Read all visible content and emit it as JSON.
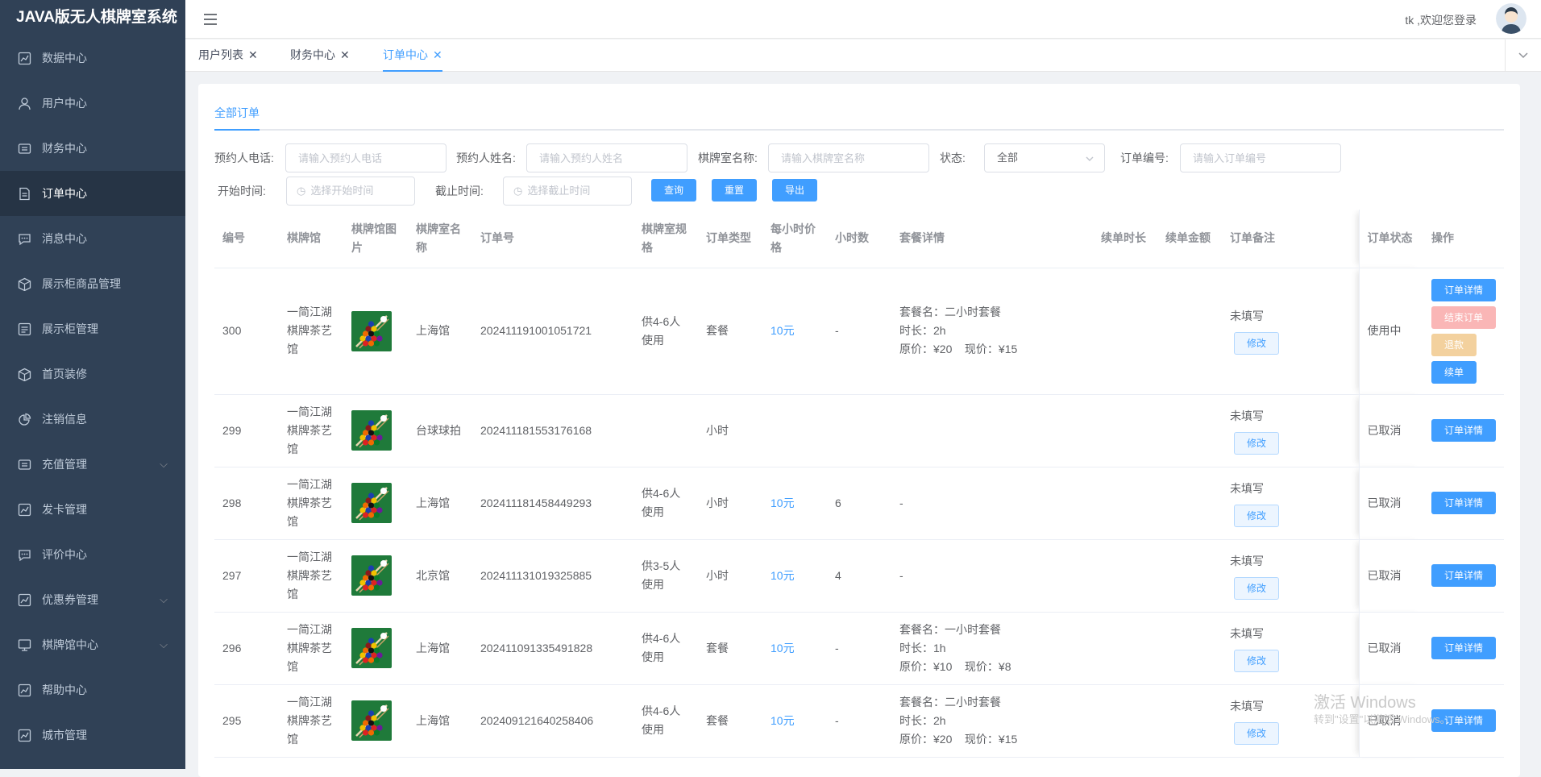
{
  "app": {
    "title": "JAVA版无人棋牌室系统"
  },
  "sidebar": {
    "items": [
      {
        "label": "数据中心",
        "icon": "chart-icon"
      },
      {
        "label": "用户中心",
        "icon": "user-icon"
      },
      {
        "label": "财务中心",
        "icon": "wallet-icon"
      },
      {
        "label": "订单中心",
        "icon": "document-icon"
      },
      {
        "label": "消息中心",
        "icon": "message-icon"
      },
      {
        "label": "展示柜商品管理",
        "icon": "box-icon"
      },
      {
        "label": "展示柜管理",
        "icon": "list-icon"
      },
      {
        "label": "首页装修",
        "icon": "box-icon"
      },
      {
        "label": "注销信息",
        "icon": "pie-icon"
      },
      {
        "label": "充值管理",
        "icon": "wallet-icon"
      },
      {
        "label": "发卡管理",
        "icon": "chart-icon"
      },
      {
        "label": "评价中心",
        "icon": "message-icon"
      },
      {
        "label": "优惠券管理",
        "icon": "chart-icon"
      },
      {
        "label": "棋牌馆中心",
        "icon": "monitor-icon"
      },
      {
        "label": "帮助中心",
        "icon": "chart-icon"
      },
      {
        "label": "城市管理",
        "icon": "chart-icon"
      }
    ]
  },
  "header": {
    "welcome": "tk ,欢迎您登录"
  },
  "tags": [
    {
      "label": "用户列表"
    },
    {
      "label": "财务中心"
    },
    {
      "label": "订单中心"
    }
  ],
  "main": {
    "tab": "全部订单"
  },
  "filters": {
    "phone_label": "预约人电话:",
    "phone_placeholder": "请输入预约人电话",
    "name_label": "预约人姓名:",
    "name_placeholder": "请输入预约人姓名",
    "room_label": "棋牌室名称:",
    "room_placeholder": "请输入棋牌室名称",
    "status_label": "状态:",
    "status_value": "全部",
    "order_label": "订单编号:",
    "order_placeholder": "请输入订单编号",
    "start_label": "开始时间:",
    "start_placeholder": "选择开始时间",
    "end_label": "截止时间:",
    "end_placeholder": "选择截止时间",
    "search": "查询",
    "reset": "重置",
    "export": "导出"
  },
  "table": {
    "headers": [
      "编号",
      "棋牌馆",
      "棋牌馆图片",
      "棋牌室名称",
      "订单号",
      "棋牌室规格",
      "订单类型",
      "每小时价格",
      "小时数",
      "套餐详情",
      "续单时长",
      "续单金额",
      "订单备注",
      "订单状态",
      "操作"
    ],
    "rows": [
      {
        "id": "300",
        "venue": "一简江湖棋牌茶艺馆",
        "room": "上海馆",
        "order_no": "202411191001051721",
        "spec": "供4-6人使用",
        "type": "套餐",
        "price": "10元",
        "hours": "-",
        "pkg_name": "套餐名：二小时套餐",
        "pkg_duration": "时长：2h",
        "pkg_price": "原价：¥20    现价：¥15",
        "pkg_plain": "",
        "renew_time": "",
        "renew_amount": "",
        "remark": "未填写",
        "edit": "修改",
        "status": "使用中",
        "actions": [
          "订单详情",
          "结束订单",
          "退款",
          "续单"
        ]
      },
      {
        "id": "299",
        "venue": "一简江湖棋牌茶艺馆",
        "room": "台球球拍",
        "order_no": "202411181553176168",
        "spec": "",
        "type": "小时",
        "price": "",
        "hours": "",
        "pkg_name": "",
        "pkg_duration": "",
        "pkg_price": "",
        "pkg_plain": "",
        "renew_time": "",
        "renew_amount": "",
        "remark": "未填写",
        "edit": "修改",
        "status": "已取消",
        "actions": [
          "订单详情"
        ]
      },
      {
        "id": "298",
        "venue": "一简江湖棋牌茶艺馆",
        "room": "上海馆",
        "order_no": "202411181458449293",
        "spec": "供4-6人使用",
        "type": "小时",
        "price": "10元",
        "hours": "6",
        "pkg_name": "",
        "pkg_duration": "",
        "pkg_price": "",
        "pkg_plain": "-",
        "renew_time": "",
        "renew_amount": "",
        "remark": "未填写",
        "edit": "修改",
        "status": "已取消",
        "actions": [
          "订单详情"
        ]
      },
      {
        "id": "297",
        "venue": "一简江湖棋牌茶艺馆",
        "room": "北京馆",
        "order_no": "202411131019325885",
        "spec": "供3-5人使用",
        "type": "小时",
        "price": "10元",
        "hours": "4",
        "pkg_name": "",
        "pkg_duration": "",
        "pkg_price": "",
        "pkg_plain": "-",
        "renew_time": "",
        "renew_amount": "",
        "remark": "未填写",
        "edit": "修改",
        "status": "已取消",
        "actions": [
          "订单详情"
        ]
      },
      {
        "id": "296",
        "venue": "一简江湖棋牌茶艺馆",
        "room": "上海馆",
        "order_no": "202411091335491828",
        "spec": "供4-6人使用",
        "type": "套餐",
        "price": "10元",
        "hours": "-",
        "pkg_name": "套餐名：一小时套餐",
        "pkg_duration": "时长：1h",
        "pkg_price": "原价：¥10    现价：¥8",
        "pkg_plain": "",
        "renew_time": "",
        "renew_amount": "",
        "remark": "未填写",
        "edit": "修改",
        "status": "已取消",
        "actions": [
          "订单详情"
        ]
      },
      {
        "id": "295",
        "venue": "一简江湖棋牌茶艺馆",
        "room": "上海馆",
        "order_no": "202409121640258406",
        "spec": "供4-6人使用",
        "type": "套餐",
        "price": "10元",
        "hours": "-",
        "pkg_name": "套餐名：二小时套餐",
        "pkg_duration": "时长：2h",
        "pkg_price": "原价：¥20    现价：¥15",
        "pkg_plain": "",
        "renew_time": "",
        "renew_amount": "",
        "remark": "未填写",
        "edit": "修改",
        "status": "已取消",
        "actions": [
          "订单详情"
        ]
      }
    ]
  },
  "watermark": {
    "line1": "激活 Windows",
    "line2": "转到\"设置\"以激活 Windows。"
  }
}
